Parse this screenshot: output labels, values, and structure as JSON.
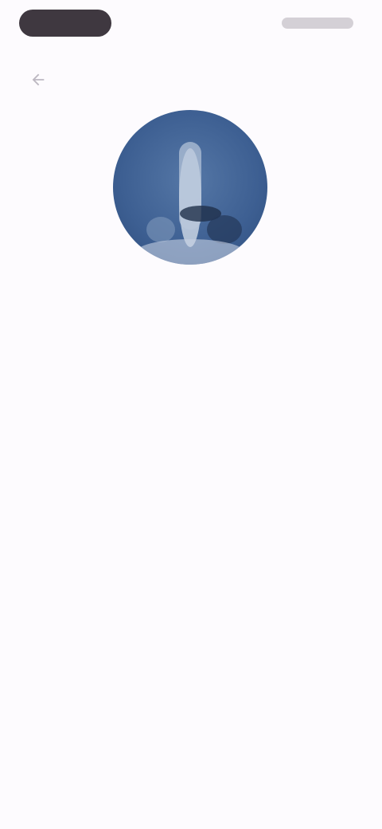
{
  "status_bar": {
    "left_indicator_icon": "status-pill",
    "right_indicators_icon": "status-icons"
  },
  "nav": {
    "back_icon": "arrow-back-icon"
  },
  "hero": {
    "image_icon": "profile-illustration"
  },
  "content": {
    "label": "",
    "description": "",
    "meta_link": ""
  },
  "colors": {
    "background": "#fdfbfe",
    "hero_blue": "#3d5f92",
    "text_primary": "#3a3540",
    "text_secondary": "#9b97a0"
  }
}
